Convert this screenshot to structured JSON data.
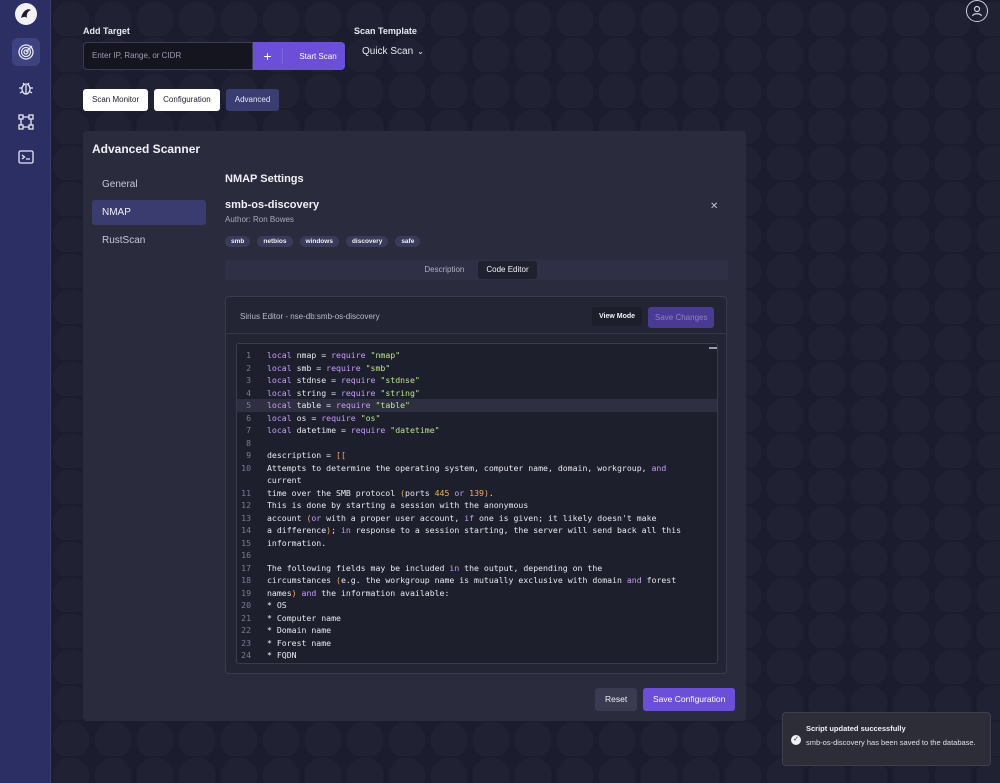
{
  "add_target": {
    "label": "Add Target",
    "placeholder": "Enter IP, Range, or CIDR",
    "start_scan_label": "Start Scan"
  },
  "scan_template": {
    "label": "Scan Template",
    "selected": "Quick Scan"
  },
  "tabs": {
    "scan_monitor": "Scan Monitor",
    "configuration": "Configuration",
    "advanced": "Advanced",
    "active": "Advanced"
  },
  "panel": {
    "title": "Advanced Scanner",
    "nav": [
      "General",
      "NMAP",
      "RustScan"
    ],
    "nav_active": "NMAP",
    "section_title": "NMAP Settings",
    "script": {
      "name": "smb-os-discovery",
      "author": "Author: Ron Bowes",
      "tags": [
        "smb",
        "netbios",
        "windows",
        "discovery",
        "safe"
      ]
    },
    "subtabs": {
      "description": "Description",
      "code_editor": "Code Editor",
      "active": "Code Editor"
    },
    "editor": {
      "title": "Sirius Editor - nse-db:smb-os-discovery",
      "view_mode": "View Mode",
      "save_changes": "Save Changes",
      "highlighted_line": 5,
      "lines": [
        {
          "n": "1",
          "code": "local nmap = require \"nmap\""
        },
        {
          "n": "2",
          "code": "local smb = require \"smb\""
        },
        {
          "n": "3",
          "code": "local stdnse = require \"stdnse\""
        },
        {
          "n": "4",
          "code": "local string = require \"string\""
        },
        {
          "n": "5",
          "code": "local table = require \"table\""
        },
        {
          "n": "6",
          "code": "local os = require \"os\""
        },
        {
          "n": "7",
          "code": "local datetime = require \"datetime\""
        },
        {
          "n": "8",
          "code": ""
        },
        {
          "n": "9",
          "code": "description = [["
        },
        {
          "n": "10",
          "code": "Attempts to determine the operating system, computer name, domain, workgroup, and"
        },
        {
          "n": "",
          "code": "current"
        },
        {
          "n": "11",
          "code": "time over the SMB protocol (ports 445 or 139)."
        },
        {
          "n": "12",
          "code": "This is done by starting a session with the anonymous"
        },
        {
          "n": "13",
          "code": "account (or with a proper user account, if one is given; it likely doesn't make"
        },
        {
          "n": "14",
          "code": "a difference); in response to a session starting, the server will send back all this"
        },
        {
          "n": "15",
          "code": "information."
        },
        {
          "n": "16",
          "code": ""
        },
        {
          "n": "17",
          "code": "The following fields may be included in the output, depending on the"
        },
        {
          "n": "18",
          "code": "circumstances (e.g. the workgroup name is mutually exclusive with domain and forest"
        },
        {
          "n": "19",
          "code": "names) and the information available:"
        },
        {
          "n": "20",
          "code": "* OS"
        },
        {
          "n": "21",
          "code": "* Computer name"
        },
        {
          "n": "22",
          "code": "* Domain name"
        },
        {
          "n": "23",
          "code": "* Forest name"
        },
        {
          "n": "24",
          "code": "* FQDN"
        }
      ]
    },
    "reset_label": "Reset",
    "save_config_label": "Save Configuration"
  },
  "toast": {
    "title": "Script updated successfully",
    "message": "smb-os-discovery has been saved to the database."
  },
  "colors": {
    "accent": "#6b4fd8",
    "sidebar": "#2b2f63",
    "panel": "#2a2b3d"
  }
}
